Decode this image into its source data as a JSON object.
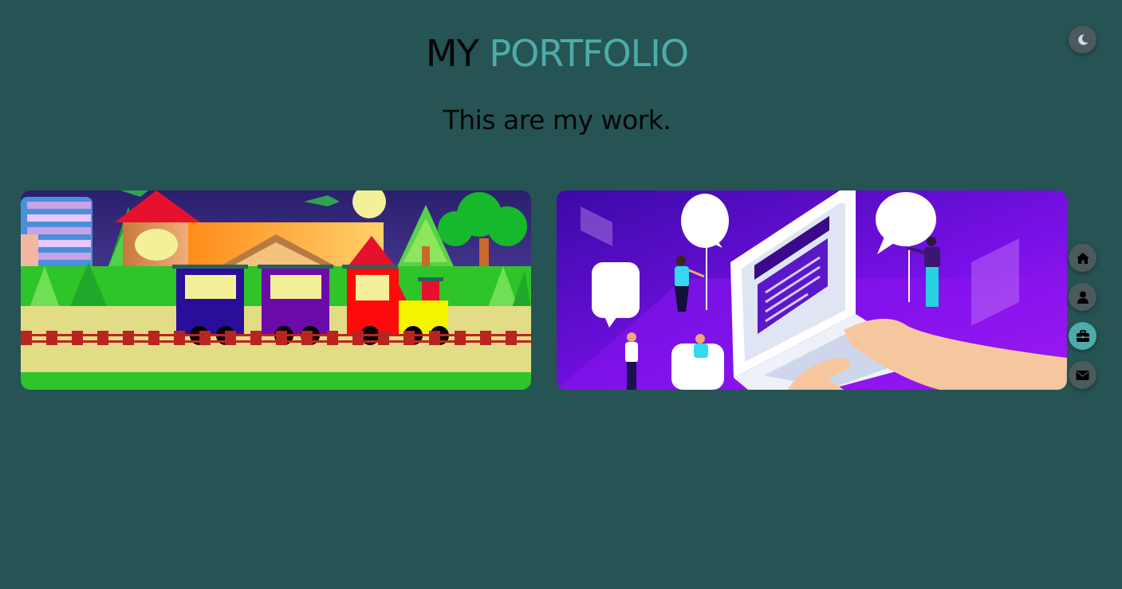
{
  "header": {
    "title_part1": "MY",
    "title_part2": "PORTFOLIO",
    "subtitle": "This are my work."
  },
  "theme_toggle": {
    "icon": "moon-icon"
  },
  "portfolio": {
    "items": [
      {
        "image": "train-village-illustration"
      },
      {
        "image": "laptop-chat-isometric-illustration"
      }
    ]
  },
  "nav": {
    "active": "portfolio",
    "items": [
      {
        "icon": "home-icon"
      },
      {
        "icon": "user-icon"
      },
      {
        "icon": "briefcase-icon"
      },
      {
        "icon": "envelope-icon"
      }
    ]
  },
  "colors": {
    "background": "#265353",
    "accent": "#4eabab",
    "button": "#4d5a5d",
    "text": "#060606"
  }
}
